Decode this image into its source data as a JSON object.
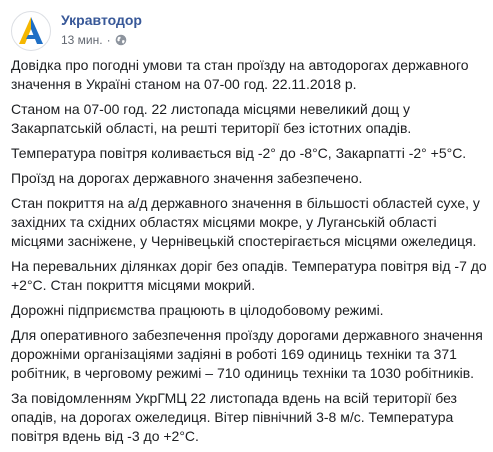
{
  "post": {
    "page_name": "Укравтодор",
    "time": "13 мин.",
    "separator": "·",
    "paragraphs": [
      "Довідка про погодні умови та стан проїзду на автодорогах державного значення в Україні станом на 07-00 год. 22.11.2018 р.",
      "Станом на 07-00 год. 22 листопада місцями невеликий дощ у Закарпатській області, на решті території без істотних опадів.",
      "Температура повітря коливається від -2° до -8°С, Закарпатті -2° +5°С.",
      "Проїзд на дорогах державного значення забезпечено.",
      "Стан покриття на а/д державного значення в більшості областей сухе, у західних та східних областях місцями мокре, у Луганській області місцями засніжене, у Чернівецькій спостерігається місцями ожеледиця.",
      "На перевальних ділянках доріг без опадів. Температура повітря від -7 до +2°С. Стан покриття місцями мокрий.",
      "Дорожні підприємства працюють в цілодобовому режимі.",
      "Для оперативного забезпечення проїзду дорогами державного значення дорожніми організаціями задіяні в роботі 169 одиниць техніки та 371 робітник, в черговому режимі – 710 одиниць техніки та 1030 робітників.",
      "За повідомленням УкрГМЦ 22 листопада вдень на всій території без опадів, на дорогах ожеледиця. Вітер північний 3-8 м/с. Температура повітря вдень від -3 до +2°С."
    ]
  },
  "colors": {
    "link": "#385898",
    "meta": "#616770",
    "text": "#1c1e21",
    "logo_yellow": "#f5b700",
    "logo_blue": "#1f6fc5"
  },
  "icons": {
    "avatar": "ukravtodor-logo-icon",
    "privacy": "globe-icon"
  }
}
